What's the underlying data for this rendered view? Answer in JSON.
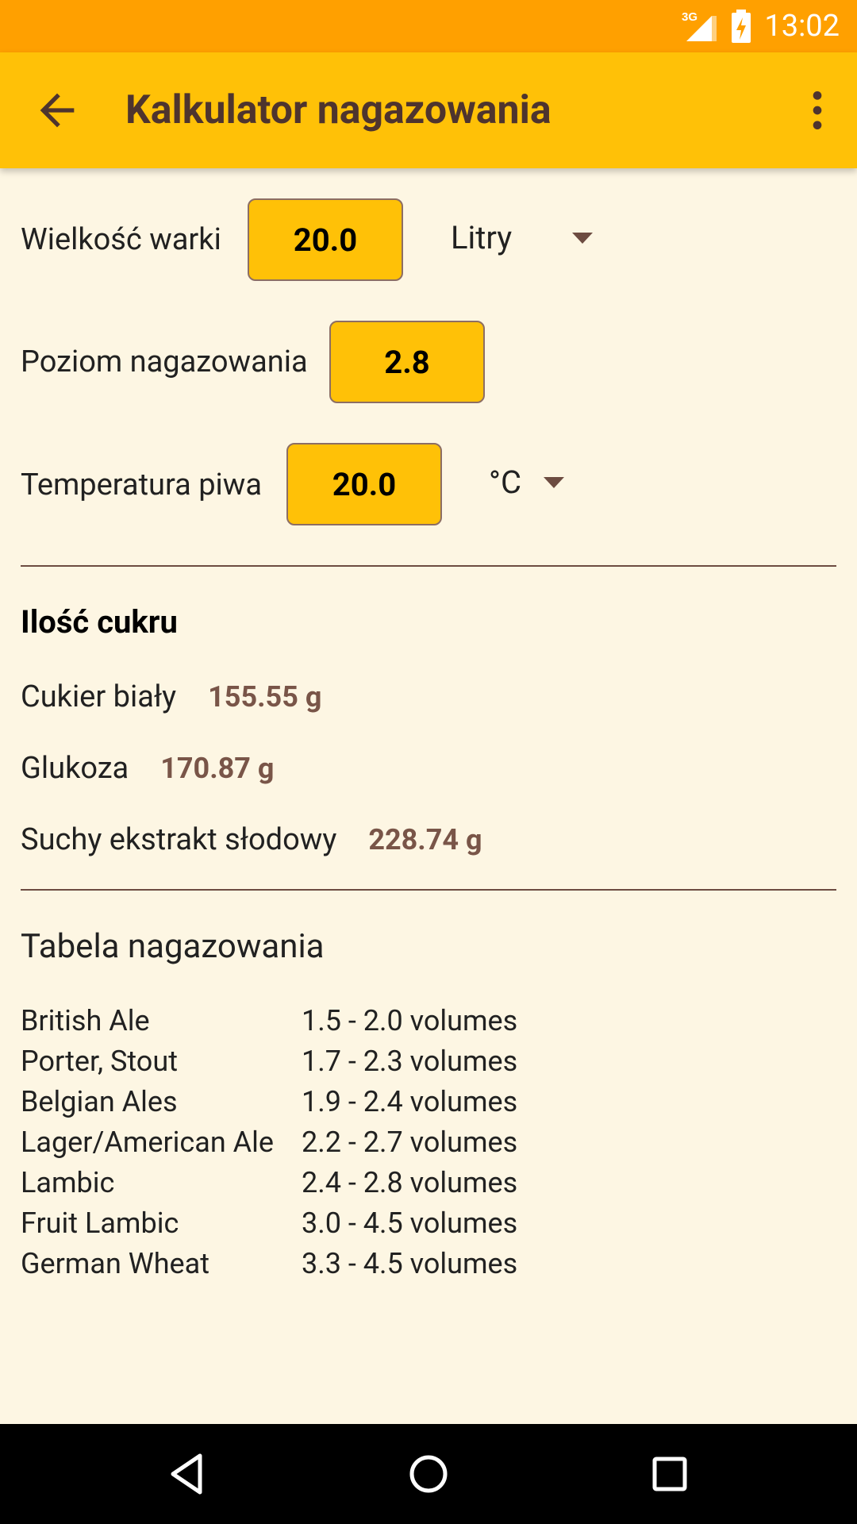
{
  "status_bar": {
    "network": "3G",
    "time": "13:02"
  },
  "appbar": {
    "title": "Kalkulator nagazowania",
    "back_icon": "arrow-back-icon",
    "menu_icon": "more-vert-icon"
  },
  "form": {
    "batch_size": {
      "label": "Wielkość warki",
      "value": "20.0",
      "unit": "Litry"
    },
    "carbonation_level": {
      "label": "Poziom nagazowania",
      "value": "2.8"
    },
    "beer_temperature": {
      "label": "Temperatura piwa",
      "value": "20.0",
      "unit": "°C"
    }
  },
  "sugar": {
    "title": "Ilość cukru",
    "items": [
      {
        "label": "Cukier biały",
        "value": "155.55 g"
      },
      {
        "label": "Glukoza",
        "value": "170.87 g"
      },
      {
        "label": "Suchy ekstrakt słodowy",
        "value": "228.74 g"
      }
    ]
  },
  "carbonation_table": {
    "title": "Tabela nagazowania",
    "rows": [
      {
        "style": "British Ale",
        "range": "1.5 - 2.0 volumes"
      },
      {
        "style": "Porter, Stout",
        "range": "1.7 - 2.3 volumes"
      },
      {
        "style": "Belgian Ales",
        "range": "1.9 - 2.4 volumes"
      },
      {
        "style": "Lager/American Ale",
        "range": "2.2 - 2.7 volumes"
      },
      {
        "style": "Lambic",
        "range": "2.4 - 2.8 volumes"
      },
      {
        "style": "Fruit Lambic",
        "range": "3.0 - 4.5 volumes"
      },
      {
        "style": "German Wheat",
        "range": "3.3 - 4.5 volumes"
      }
    ]
  },
  "nav_bar": {
    "back_icon": "nav-back-icon",
    "home_icon": "nav-home-icon",
    "recents_icon": "nav-recents-icon"
  },
  "colors": {
    "status_bar": "#ffa000",
    "appbar": "#ffc107",
    "background": "#fdf6e3",
    "accent_brown": "#795548"
  }
}
